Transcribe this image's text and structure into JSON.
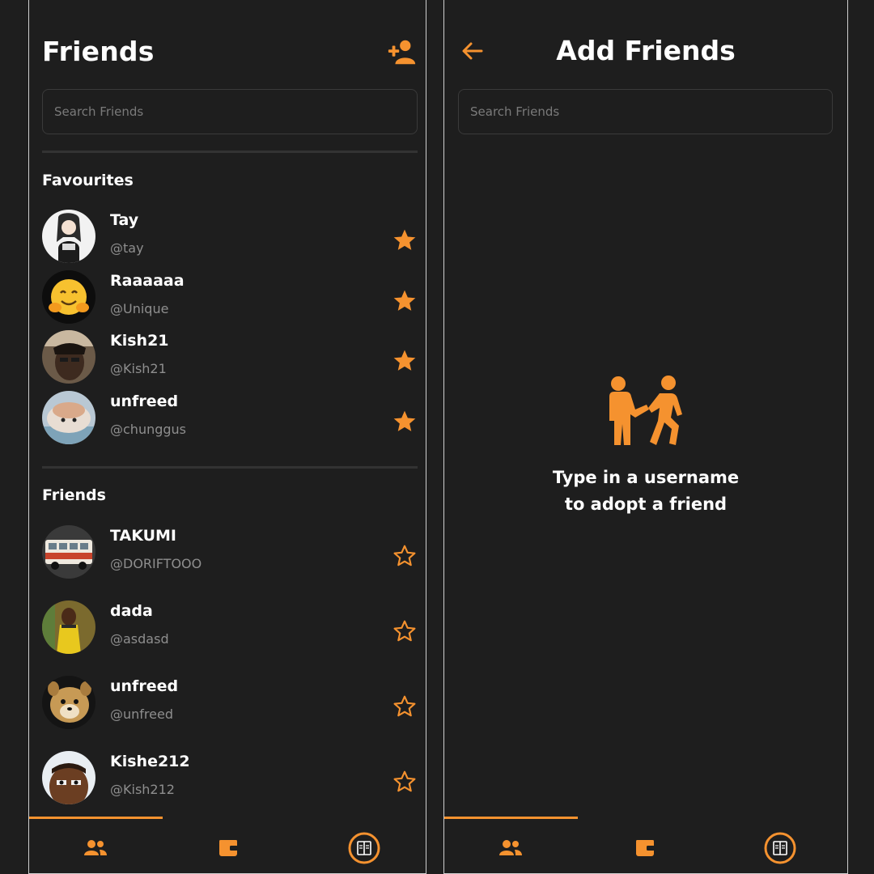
{
  "accent": "#f5922f",
  "left": {
    "title": "Friends",
    "add_icon": "person-add-icon",
    "search": {
      "placeholder": "Search Friends",
      "value": ""
    },
    "favourites_title": "Favourites",
    "favourites": [
      {
        "name": "Tay",
        "handle": "@tay",
        "starred": true
      },
      {
        "name": "Raaaaaa",
        "handle": "@Unique",
        "starred": true
      },
      {
        "name": "Kish21",
        "handle": "@Kish21",
        "starred": true
      },
      {
        "name": "unfreed",
        "handle": "@chunggus",
        "starred": true
      }
    ],
    "friends_title": "Friends",
    "friends": [
      {
        "name": "TAKUMI",
        "handle": "@DORIFTOOO",
        "starred": false
      },
      {
        "name": "dada",
        "handle": "@asdasd",
        "starred": false
      },
      {
        "name": "unfreed",
        "handle": "@unfreed",
        "starred": false
      },
      {
        "name": "Kishe212",
        "handle": "@Kish212",
        "starred": false
      }
    ]
  },
  "right": {
    "title": "Add Friends",
    "back_icon": "arrow-left-icon",
    "search": {
      "placeholder": "Search Friends",
      "value": ""
    },
    "empty_icon": "people-walking-icon",
    "empty_line1": "Type in a username",
    "empty_line2": "to adopt a friend"
  },
  "nav": {
    "items": [
      {
        "icon": "people-icon"
      },
      {
        "icon": "wallet-icon"
      },
      {
        "icon": "book-icon"
      }
    ]
  }
}
